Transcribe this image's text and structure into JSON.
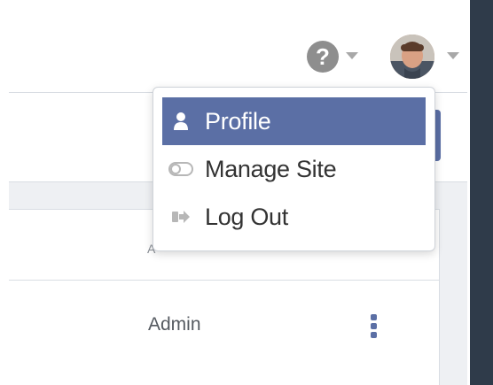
{
  "header": {
    "help_glyph": "?",
    "help_icon": "question-circle-icon",
    "caret_icon": "caret-down-icon",
    "avatar_icon": "user-avatar"
  },
  "menu": {
    "items": [
      {
        "label": "Profile",
        "icon": "user-icon",
        "active": true
      },
      {
        "label": "Manage Site",
        "icon": "toggle-icon",
        "active": false
      },
      {
        "label": "Log Out",
        "icon": "sign-out-icon",
        "active": false
      }
    ]
  },
  "table": {
    "header_partial": "A",
    "rows": [
      {
        "role": "Admin",
        "actions_icon": "kebab-menu-icon"
      }
    ]
  },
  "colors": {
    "accent": "#5b6fa5",
    "icon_gray": "#8e8e8e",
    "background": "#eef0f3"
  }
}
